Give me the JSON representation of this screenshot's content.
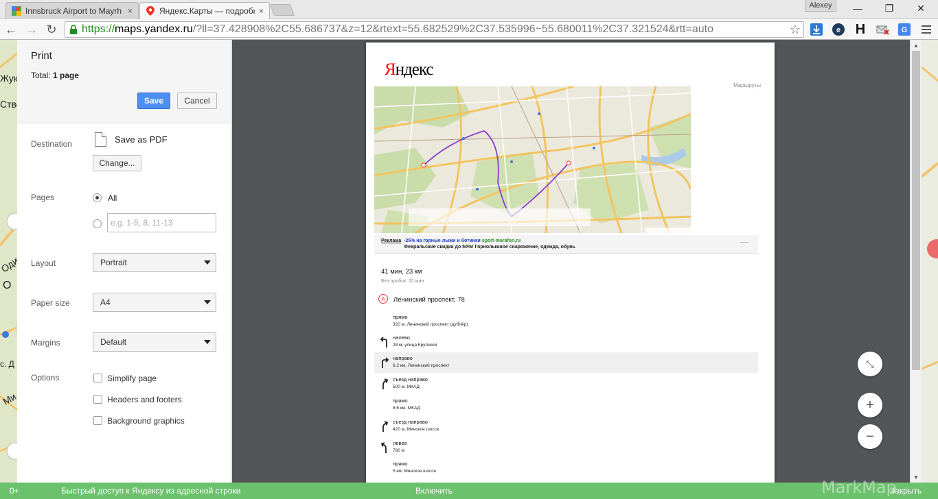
{
  "browser": {
    "tabs": [
      {
        "title": "Innsbruck Airport to Mayrh",
        "close": "×"
      },
      {
        "title": "Яндекс.Карты — подробн",
        "close": "×"
      }
    ],
    "user": "Alexey",
    "window_controls": {
      "minimize": "—",
      "maximize": "❐",
      "close": "✕"
    },
    "url": {
      "scheme": "https://",
      "host": "maps.yandex.ru",
      "path": "/?ll=37.428908%2C55.686737&z=12&rtext=55.682529%2C37.535996~55.680011%2C37.321524&rtt=auto"
    },
    "extensions": [
      "download-icon",
      "eset-icon",
      "h-icon",
      "mail-icon",
      "translate-icon",
      "menu-icon"
    ]
  },
  "background_map": {
    "labels": [
      "Жуков",
      "Ство",
      "Один",
      "О",
      "с. Д",
      "Ми"
    ]
  },
  "print": {
    "title": "Print",
    "total_label": "Total:",
    "total_value": "1 page",
    "save": "Save",
    "cancel": "Cancel",
    "destination_label": "Destination",
    "destination_value": "Save as PDF",
    "change": "Change...",
    "pages_label": "Pages",
    "pages_all": "All",
    "pages_placeholder": "e.g. 1-5, 8, 11-13",
    "layout_label": "Layout",
    "layout_value": "Portrait",
    "paper_label": "Paper size",
    "paper_value": "A4",
    "margins_label": "Margins",
    "margins_value": "Default",
    "options_label": "Options",
    "options": [
      "Simplify page",
      "Headers and footers",
      "Background graphics"
    ]
  },
  "preview": {
    "logo": {
      "first": "Я",
      "rest": "ндекс"
    },
    "routes_link": "Маршруты",
    "ad": {
      "label": "Реклама",
      "line1_a": "-25% на горные лыжи и ботинки ",
      "line1_b": "sport-marafon.ru",
      "line2": "Февральские скидки до 50%! Горнолыжное снаряжение, одежда, обувь"
    },
    "summary": "41 мин, 23 км",
    "no_traffic": "Без пробок: 32 мин",
    "start_marker": "А",
    "start": "Ленинский проспект, 78",
    "steps": [
      {
        "action": "прямо",
        "detail": "320 м, Ленинский проспект (дублёр)",
        "icon": "straight"
      },
      {
        "action": "налево",
        "detail": "28 м, улица Крупской",
        "icon": "left"
      },
      {
        "action": "направо",
        "detail": "6,2 км, Ленинский проспект",
        "icon": "right"
      },
      {
        "action": "съезд направо",
        "detail": "500 м, МКАД",
        "icon": "exit-right"
      },
      {
        "action": "прямо",
        "detail": "8,6 км, МКАД",
        "icon": "straight"
      },
      {
        "action": "съезд направо",
        "detail": "420 м, Минское шоссе",
        "icon": "exit-right"
      },
      {
        "action": "левее",
        "detail": "780 м",
        "icon": "bear-left"
      },
      {
        "action": "прямо",
        "detail": "5 км, Минское шоссе",
        "icon": "straight"
      }
    ],
    "controls": {
      "fit": "⤡",
      "zoom_in": "+",
      "zoom_out": "−"
    }
  },
  "bottom_bar": {
    "left": "0+",
    "message": "Быстрый доступ к Яндексу из адресной строки",
    "enable": "Включить",
    "close": "Закрыть",
    "watermark": "MarkMap"
  },
  "colors": {
    "save_button": "#4d8ff3",
    "bottom_bar": "#6cc16d",
    "preview_bg": "#525659",
    "route_line": "#8a3fd1",
    "url_secure": "#1e8e1e"
  }
}
